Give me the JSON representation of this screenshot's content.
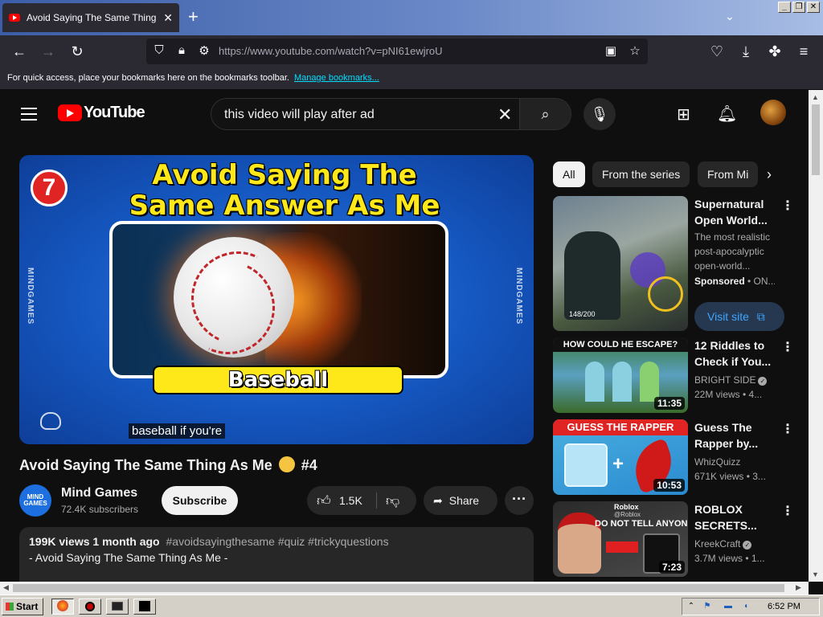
{
  "browser": {
    "tab_title": "Avoid Saying The Same Thing As Me",
    "url": "https://www.youtube.com/watch?v=pNI61ewjroU",
    "bookmarks_text": "For quick access, place your bookmarks here on the bookmarks toolbar.",
    "bookmarks_link": "Manage bookmarks..."
  },
  "masthead": {
    "logo": "YouTube",
    "search_query": "this video will play after ad"
  },
  "player": {
    "badge": "7",
    "headline_line1": "Avoid Saying The",
    "headline_line2": "Same Answer As Me",
    "answer": "Baseball",
    "watermark": "MINDGAMES",
    "caption": "baseball if you're"
  },
  "video": {
    "title": "Avoid Saying The Same Thing As Me",
    "title_suffix": "#4",
    "channel_avatar_text": "MIND GAMES",
    "channel": "Mind Games",
    "subscribers": "72.4K subscribers",
    "subscribe_label": "Subscribe",
    "likes": "1.5K",
    "share_label": "Share",
    "views": "199K views",
    "age": "1 month ago",
    "hashtags": "#avoidsayingthesame #quiz #trickyquestions",
    "desc_line2": "- Avoid Saying The Same Thing As Me -"
  },
  "chips": [
    "All",
    "From the series",
    "From Mi"
  ],
  "recommendations": [
    {
      "title": "Supernatural Open World...",
      "line1": "The most realistic",
      "line2": "post-apocalyptic",
      "line3": "open-world...",
      "sponsored": "Sponsored",
      "sponsor_suffix": " • ON...",
      "cta": "Visit site",
      "thumb_text": "148/200"
    },
    {
      "title": "12 Riddles to Check if You...",
      "channel": "BRIGHT SIDE",
      "meta": "22M views • 4...",
      "duration": "11:35",
      "thumb_text": "HOW COULD HE ESCAPE?"
    },
    {
      "title": "Guess The Rapper by...",
      "channel": "WhizQuizz",
      "meta": "671K views • 3...",
      "duration": "10:53",
      "thumb_text": "GUESS THE RAPPER"
    },
    {
      "title": "ROBLOX SECRETS...",
      "channel": "KreekCraft",
      "meta": "3.7M views • 1...",
      "duration": "7:23",
      "thumb_text": "DO NOT TELL ANYONE",
      "thumb_text2": "Roblox",
      "thumb_text3": "@Roblox"
    }
  ],
  "taskbar": {
    "start": "Start",
    "clock": "6:52 PM"
  }
}
